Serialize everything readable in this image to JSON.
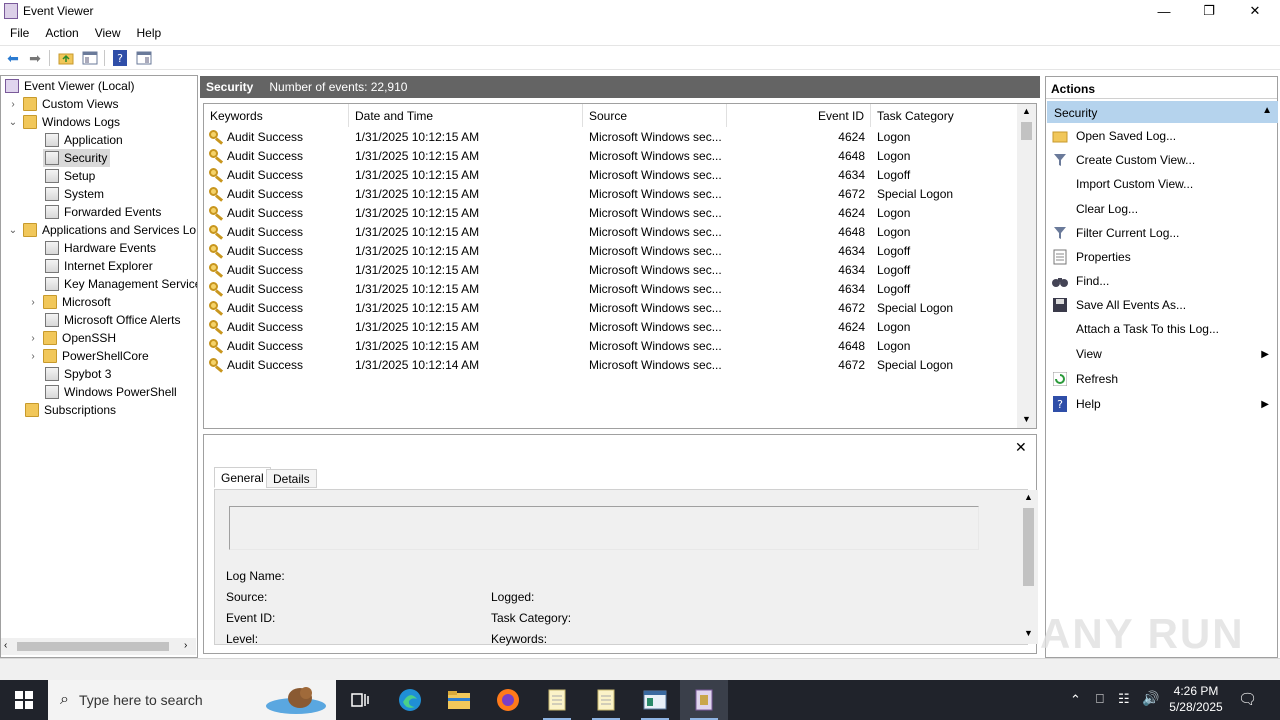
{
  "window": {
    "title": "Event Viewer"
  },
  "menu": [
    "File",
    "Action",
    "View",
    "Help"
  ],
  "tree": {
    "root": "Event Viewer (Local)",
    "items": [
      {
        "label": "Custom Views"
      },
      {
        "label": "Windows Logs"
      },
      {
        "label": "Application"
      },
      {
        "label": "Security"
      },
      {
        "label": "Setup"
      },
      {
        "label": "System"
      },
      {
        "label": "Forwarded Events"
      },
      {
        "label": "Applications and Services Lo"
      },
      {
        "label": "Hardware Events"
      },
      {
        "label": "Internet Explorer"
      },
      {
        "label": "Key Management Service"
      },
      {
        "label": "Microsoft"
      },
      {
        "label": "Microsoft Office Alerts"
      },
      {
        "label": "OpenSSH"
      },
      {
        "label": "PowerShellCore"
      },
      {
        "label": "Spybot 3"
      },
      {
        "label": "Windows PowerShell"
      },
      {
        "label": "Subscriptions"
      }
    ]
  },
  "center": {
    "log_name": "Security",
    "count_text": "Number of events: 22,910"
  },
  "grid": {
    "columns": [
      "Keywords",
      "Date and Time",
      "Source",
      "Event ID",
      "Task Category"
    ],
    "rows": [
      {
        "kw": "Audit Success",
        "dt": "1/31/2025 10:12:15 AM",
        "src": "Microsoft Windows sec...",
        "id": "4624",
        "cat": "Logon"
      },
      {
        "kw": "Audit Success",
        "dt": "1/31/2025 10:12:15 AM",
        "src": "Microsoft Windows sec...",
        "id": "4648",
        "cat": "Logon"
      },
      {
        "kw": "Audit Success",
        "dt": "1/31/2025 10:12:15 AM",
        "src": "Microsoft Windows sec...",
        "id": "4634",
        "cat": "Logoff"
      },
      {
        "kw": "Audit Success",
        "dt": "1/31/2025 10:12:15 AM",
        "src": "Microsoft Windows sec...",
        "id": "4672",
        "cat": "Special Logon"
      },
      {
        "kw": "Audit Success",
        "dt": "1/31/2025 10:12:15 AM",
        "src": "Microsoft Windows sec...",
        "id": "4624",
        "cat": "Logon"
      },
      {
        "kw": "Audit Success",
        "dt": "1/31/2025 10:12:15 AM",
        "src": "Microsoft Windows sec...",
        "id": "4648",
        "cat": "Logon"
      },
      {
        "kw": "Audit Success",
        "dt": "1/31/2025 10:12:15 AM",
        "src": "Microsoft Windows sec...",
        "id": "4634",
        "cat": "Logoff"
      },
      {
        "kw": "Audit Success",
        "dt": "1/31/2025 10:12:15 AM",
        "src": "Microsoft Windows sec...",
        "id": "4634",
        "cat": "Logoff"
      },
      {
        "kw": "Audit Success",
        "dt": "1/31/2025 10:12:15 AM",
        "src": "Microsoft Windows sec...",
        "id": "4634",
        "cat": "Logoff"
      },
      {
        "kw": "Audit Success",
        "dt": "1/31/2025 10:12:15 AM",
        "src": "Microsoft Windows sec...",
        "id": "4672",
        "cat": "Special Logon"
      },
      {
        "kw": "Audit Success",
        "dt": "1/31/2025 10:12:15 AM",
        "src": "Microsoft Windows sec...",
        "id": "4624",
        "cat": "Logon"
      },
      {
        "kw": "Audit Success",
        "dt": "1/31/2025 10:12:15 AM",
        "src": "Microsoft Windows sec...",
        "id": "4648",
        "cat": "Logon"
      },
      {
        "kw": "Audit Success",
        "dt": "1/31/2025 10:12:14 AM",
        "src": "Microsoft Windows sec...",
        "id": "4672",
        "cat": "Special Logon"
      }
    ]
  },
  "details": {
    "tabs": [
      "General",
      "Details"
    ],
    "fields": {
      "log_name": "Log Name:",
      "source": "Source:",
      "event_id": "Event ID:",
      "level": "Level:",
      "logged": "Logged:",
      "task_category": "Task Category:",
      "keywords": "Keywords:"
    }
  },
  "actions": {
    "title": "Actions",
    "section": "Security",
    "items": [
      {
        "label": "Open Saved Log...",
        "icon": "open-folder-icon"
      },
      {
        "label": "Create Custom View...",
        "icon": "filter-icon"
      },
      {
        "label": "Import Custom View...",
        "icon": ""
      },
      {
        "label": "Clear Log...",
        "icon": ""
      },
      {
        "label": "Filter Current Log...",
        "icon": "filter-icon"
      },
      {
        "label": "Properties",
        "icon": "properties-icon"
      },
      {
        "label": "Find...",
        "icon": "binoculars-icon"
      },
      {
        "label": "Save All Events As...",
        "icon": "save-icon"
      },
      {
        "label": "Attach a Task To this Log...",
        "icon": ""
      },
      {
        "label": "View",
        "icon": ""
      },
      {
        "label": "Refresh",
        "icon": "refresh-icon"
      },
      {
        "label": "Help",
        "icon": "help-icon"
      }
    ]
  },
  "taskbar": {
    "search_placeholder": "Type here to search",
    "time": "4:26 PM",
    "date": "5/28/2025"
  },
  "watermark": "ANY RUN",
  "colors": {
    "header_gray": "#646464",
    "section_blue": "#b5d3ed",
    "taskbar": "#20232b"
  }
}
